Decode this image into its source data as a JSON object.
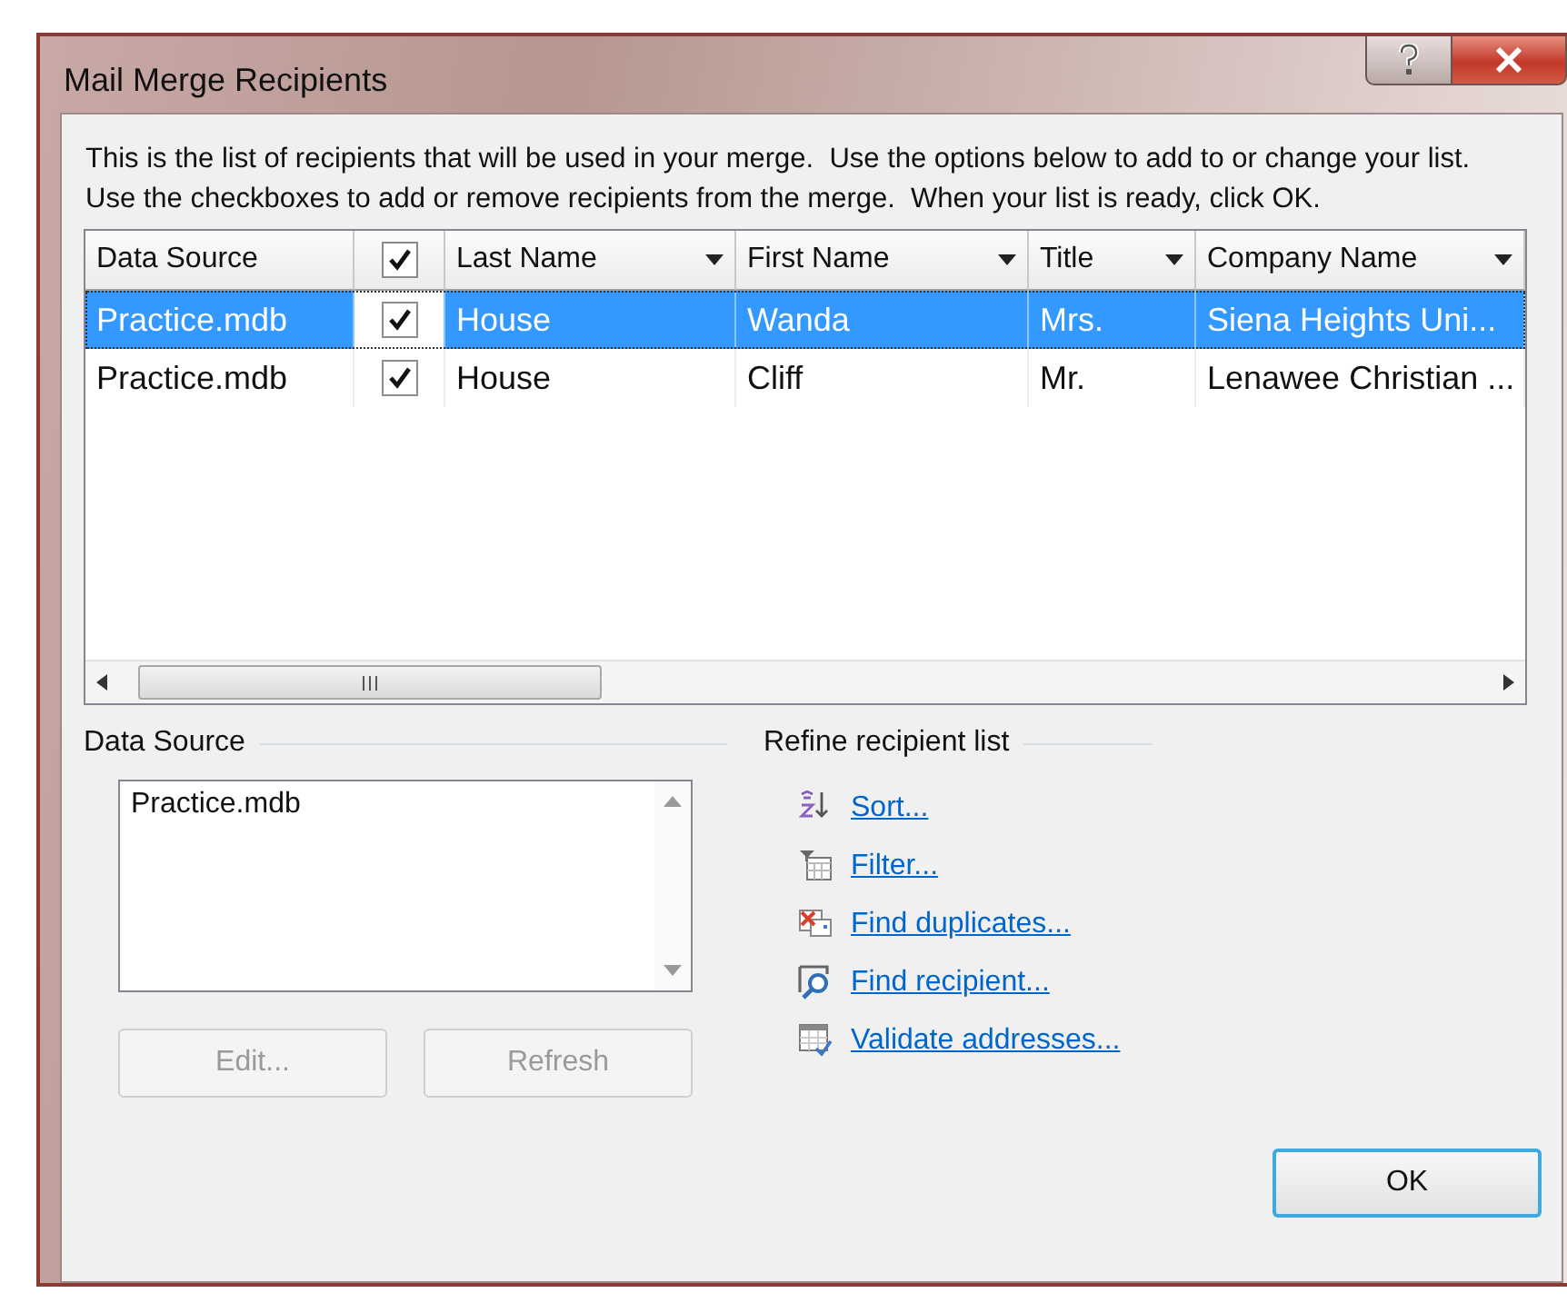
{
  "window": {
    "title": "Mail Merge Recipients"
  },
  "intro": "This is the list of recipients that will be used in your merge.  Use the options below to add to or change your list.  Use the checkboxes to add or remove recipients from the merge.  When your list is ready, click OK.",
  "table": {
    "columns": [
      {
        "kind": "text",
        "label": "Data Source"
      },
      {
        "kind": "checkbox",
        "checked": true
      },
      {
        "kind": "dropdown",
        "label": "Last Name"
      },
      {
        "kind": "dropdown",
        "label": "First Name"
      },
      {
        "kind": "dropdown",
        "label": "Title"
      },
      {
        "kind": "dropdown",
        "label": "Company Name"
      }
    ],
    "rows": [
      {
        "selected": true,
        "checked": true,
        "cells": [
          "Practice.mdb",
          "",
          "House",
          "Wanda",
          "Mrs.",
          "Siena Heights Uni..."
        ]
      },
      {
        "selected": false,
        "checked": true,
        "cells": [
          "Practice.mdb",
          "",
          "House",
          "Cliff",
          "Mr.",
          "Lenawee Christian ..."
        ]
      }
    ]
  },
  "data_source": {
    "label": "Data Source",
    "items": [
      "Practice.mdb"
    ],
    "buttons": [
      {
        "label": "Edit...",
        "disabled": true
      },
      {
        "label": "Refresh",
        "disabled": true
      }
    ]
  },
  "refine": {
    "label": "Refine recipient list",
    "links": [
      {
        "kind": "sort",
        "label": "Sort..."
      },
      {
        "kind": "filter",
        "label": "Filter..."
      },
      {
        "kind": "duplicates",
        "label": "Find duplicates..."
      },
      {
        "kind": "find",
        "label": "Find recipient..."
      },
      {
        "kind": "validate",
        "label": "Validate addresses..."
      }
    ]
  },
  "buttons": [
    "OK"
  ]
}
